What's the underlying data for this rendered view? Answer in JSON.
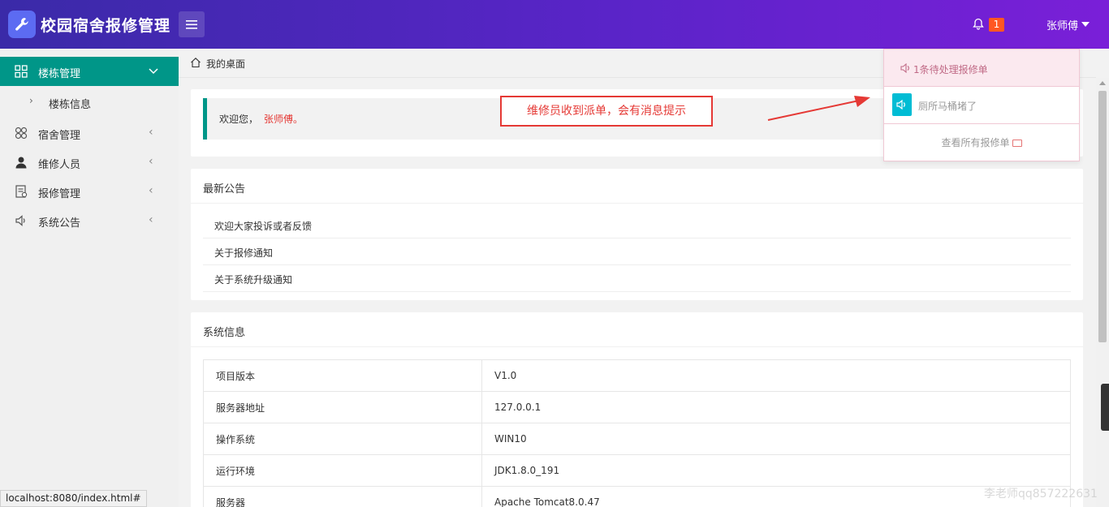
{
  "header": {
    "app_title": "校园宿舍报修管理",
    "notification_count": "1",
    "user_name": "张师傅"
  },
  "sidebar": {
    "items": [
      {
        "label": "楼栋管理",
        "icon": "grid-icon"
      },
      {
        "label": "楼栋信息",
        "icon": "chevron-right-icon"
      },
      {
        "label": "宿舍管理",
        "icon": "clover-icon"
      },
      {
        "label": "维修人员",
        "icon": "user-icon"
      },
      {
        "label": "报修管理",
        "icon": "form-icon"
      },
      {
        "label": "系统公告",
        "icon": "speaker-icon"
      }
    ]
  },
  "breadcrumb": {
    "label": "我的桌面"
  },
  "welcome": {
    "prefix": "欢迎您，",
    "name": "张师傅。"
  },
  "notices": {
    "title": "最新公告",
    "items": [
      "欢迎大家投诉或者反馈",
      "关于报修通知",
      "关于系统升级通知"
    ]
  },
  "system_info": {
    "title": "系统信息",
    "rows": [
      {
        "key": "项目版本",
        "value": "V1.0"
      },
      {
        "key": "服务器地址",
        "value": "127.0.0.1"
      },
      {
        "key": "操作系统",
        "value": "WIN10"
      },
      {
        "key": "运行环境",
        "value": "JDK1.8.0_191"
      },
      {
        "key": "服务器",
        "value": "Apache Tomcat8.0.47"
      }
    ]
  },
  "dropdown": {
    "header": "1条待处理报修单",
    "item": "厕所马桶堵了",
    "footer": "查看所有报修单"
  },
  "annotation": "维修员收到派单，会有消息提示",
  "status_url": "localhost:8080/index.html#",
  "watermark": "李老师qq857222631",
  "colors": {
    "header_start": "#3a2aa8",
    "header_end": "#7a1fd8",
    "active": "#009688",
    "accent_red": "#e53935",
    "badge": "#ff5722"
  }
}
